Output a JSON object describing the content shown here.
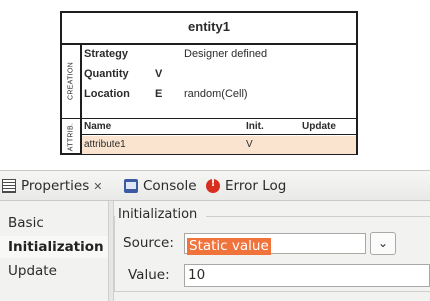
{
  "diagram": {
    "entity_title": "entity1",
    "creation_label": "CREATION",
    "attrib_label": "ATTRIB.",
    "creation_rows": [
      {
        "label": "Strategy",
        "flag": "",
        "value": "Designer defined"
      },
      {
        "label": "Quantity",
        "flag": "V",
        "value": ""
      },
      {
        "label": "Location",
        "flag": "E",
        "value": "random(Cell)"
      }
    ],
    "attr_headers": {
      "name": "Name",
      "init": "Init.",
      "update": "Update"
    },
    "attr_rows": [
      {
        "name": "attribute1",
        "init": "V",
        "update": ""
      }
    ],
    "highlight_color": "#fbe4cf"
  },
  "tabs": {
    "properties": {
      "label": "Properties",
      "icon": "properties-icon",
      "close": "✕"
    },
    "console": {
      "label": "Console",
      "icon": "console-icon"
    },
    "error_log": {
      "label": "Error Log",
      "icon": "error-log-icon"
    }
  },
  "nav": {
    "items": [
      {
        "label": "Basic"
      },
      {
        "label": "Initialization",
        "selected": true
      },
      {
        "label": "Update"
      }
    ]
  },
  "panel": {
    "group_title": "Initialization",
    "source_label": "Source:",
    "source_value": "Static value",
    "value_label": "Value:",
    "value_value": "10",
    "selection_color": "#f0733b"
  }
}
